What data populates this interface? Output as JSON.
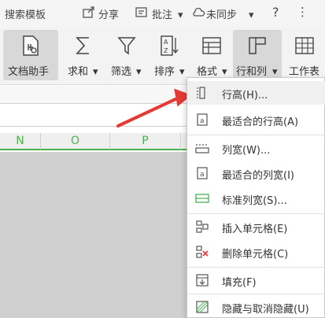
{
  "topbar": {
    "template_search": "搜索模板",
    "share": "分享",
    "comment": "批注",
    "sync_status": "未同步",
    "help": "?",
    "more": "⋮"
  },
  "ribbon": {
    "doc_assistant": "文档助手",
    "sum": "求和",
    "filter": "筛选",
    "sort": "排序",
    "format": "格式",
    "row_col": "行和列",
    "worksheet": "工作表",
    "caret": "▾"
  },
  "sheet": {
    "columns": [
      "N",
      "O",
      "P"
    ]
  },
  "menu": {
    "items": [
      {
        "label": "行高(H)...",
        "icon": "row-height-icon"
      },
      {
        "label": "最适合的行高(A)",
        "icon": "best-fit-row-height-icon"
      },
      {
        "label": "列宽(W)...",
        "icon": "column-width-icon"
      },
      {
        "label": "最适合的列宽(I)",
        "icon": "best-fit-column-width-icon"
      },
      {
        "label": "标准列宽(S)...",
        "icon": "standard-column-width-icon"
      },
      {
        "label": "插入单元格(E)",
        "icon": "insert-cells-icon"
      },
      {
        "label": "删除单元格(C)",
        "icon": "delete-cells-icon"
      },
      {
        "label": "填充(F)",
        "icon": "fill-icon"
      },
      {
        "label": "隐藏与取消隐藏(U)",
        "icon": "hide-unhide-icon"
      }
    ]
  },
  "colors": {
    "accent_green": "#4caf50",
    "arrow_red": "#e53935"
  }
}
